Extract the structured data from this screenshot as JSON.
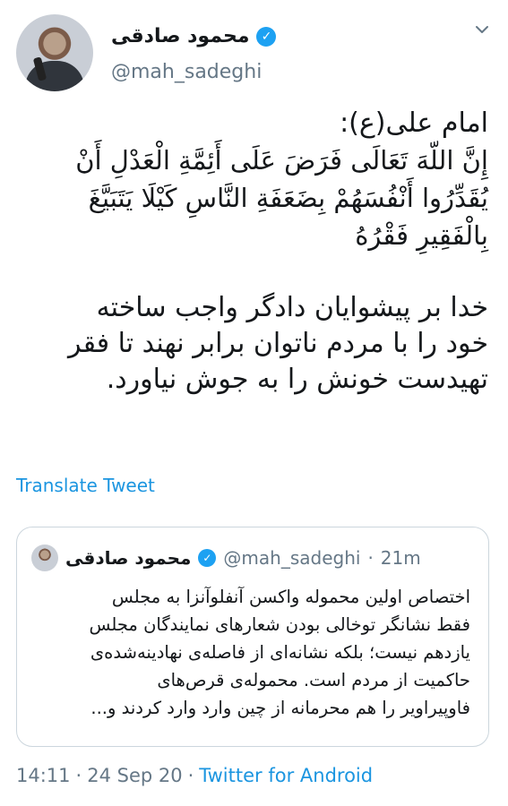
{
  "tweet": {
    "author_name": "محمود صادقی",
    "author_handle": "@mah_sadeghi",
    "lines": [
      "امام علی(ع):",
      "إِنَّ اللّهَ تَعَالَی فَرَضَ عَلَی أَئِمَّةِ الْعَدْلِ أَنْ",
      "يُقَدِّرُوا أَنْفُسَهُمْ بِضَعَفَةِ النَّاسِ كَيْلَا يَتَبَيَّغَ",
      "بِالْفَقِيرِ فَقْرُهُ",
      "",
      "خدا بر پیشوایان دادگر واجب ساخته",
      "خود را با مردم ناتوان برابر نهند تا فقر",
      "تهیدست خونش را به جوش نیاورد."
    ],
    "translate_label": "Translate Tweet"
  },
  "quote": {
    "author_name": "محمود صادقی",
    "author_handle": "@mah_sadeghi",
    "separator": "·",
    "time": "21m",
    "lines": [
      "اختصاص اولین محموله واکسن آنفلوآنزا به مجلس",
      "فقط نشانگر توخالی بودن شعارهای نمایندگان مجلس",
      "یازدهم نیست؛ بلکه نشانه‌ای از فاصله‌ی نهادینه‌شده‌ی",
      "حاکمیت از مردم است. محموله‌ی قرص‌های",
      "فاوپیراویر را هم محرمانه از چین وارد وارد کردند و..."
    ]
  },
  "footer": {
    "time": "14:11",
    "separator1": "·",
    "date": "24 Sep 20",
    "separator2": "·",
    "source": "Twitter for Android"
  },
  "colors": {
    "link": "#1b95e0",
    "verified": "#1da1f2",
    "muted": "#657786",
    "border": "#ccd6dd"
  },
  "icons": {
    "verified": "verified-badge-icon",
    "menu": "chevron-down-icon"
  }
}
